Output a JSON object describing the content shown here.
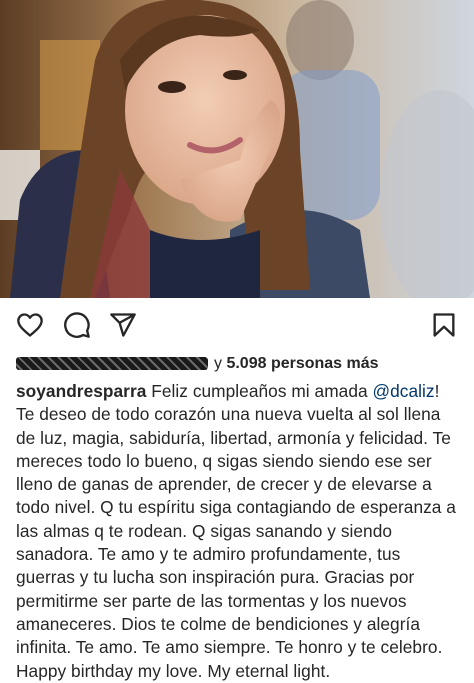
{
  "post": {
    "image_alt": "photo",
    "actions": [
      {
        "name": "like",
        "icon": "heart-icon"
      },
      {
        "name": "comment",
        "icon": "comment-icon"
      },
      {
        "name": "share",
        "icon": "paper-plane-icon"
      },
      {
        "name": "save",
        "icon": "bookmark-icon"
      }
    ],
    "likes": {
      "connector": "y",
      "count_text": "5.098 personas más"
    },
    "caption": {
      "username": "soyandresparra",
      "text_before": " Feliz cumpleaños mi amada ",
      "mention": "@dcaliz",
      "text_after": "! Te deseo de todo corazón una nueva vuelta al sol llena de luz, magia, sabiduría, libertad, armonía y felicidad. Te mereces todo lo bueno, q sigas siendo siendo ese ser lleno de ganas de aprender, de crecer y de elevarse a todo nivel. Q tu espíritu siga contagiando de esperanza a las almas q te rodean. Q sigas sanando y siendo sanadora. Te amo y te admiro profundamente, tus guerras y tu lucha son inspiración pura. Gracias por permitirme ser parte de las tormentas y los nuevos amaneceres. Dios te colme de bendiciones y alegría infinita. Te amo. Te amo siempre. Te honro y te celebro. Happy birthday my love. My eternal light."
    },
    "colors": {
      "text": "#262626",
      "mention": "#00376b",
      "background": "#ffffff"
    }
  }
}
